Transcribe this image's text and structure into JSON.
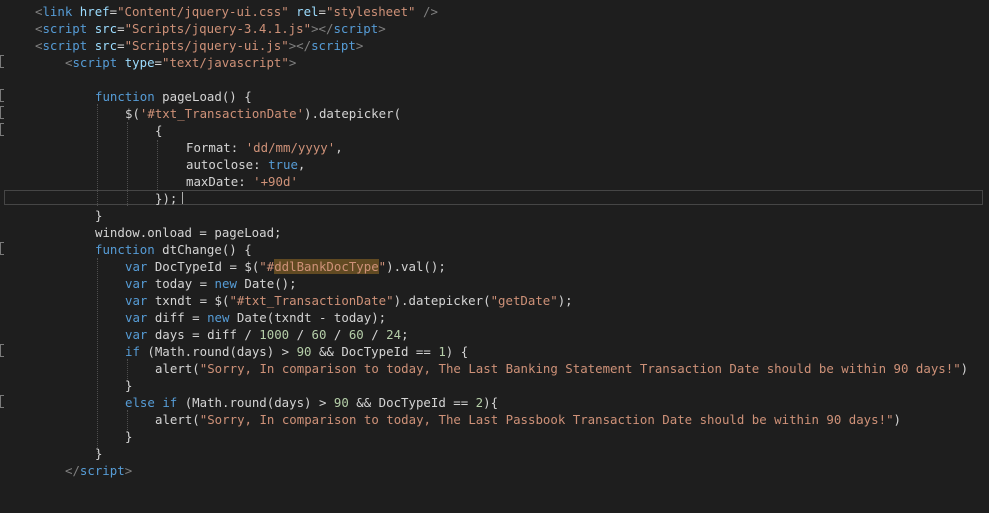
{
  "editor": {
    "lines": [
      {
        "tokens": [
          {
            "text": "<",
            "class": "tag-bracket"
          },
          {
            "text": "link",
            "class": "tag-name"
          },
          {
            "text": " ",
            "class": "plain"
          },
          {
            "text": "href",
            "class": "attr-name"
          },
          {
            "text": "=",
            "class": "plain"
          },
          {
            "text": "\"Content/jquery-ui.css\"",
            "class": "string"
          },
          {
            "text": " ",
            "class": "plain"
          },
          {
            "text": "rel",
            "class": "attr-name"
          },
          {
            "text": "=",
            "class": "plain"
          },
          {
            "text": "\"stylesheet\"",
            "class": "string"
          },
          {
            "text": " />",
            "class": "tag-bracket"
          }
        ]
      },
      {
        "tokens": [
          {
            "text": "<",
            "class": "tag-bracket"
          },
          {
            "text": "script",
            "class": "tag-name"
          },
          {
            "text": " ",
            "class": "plain"
          },
          {
            "text": "src",
            "class": "attr-name"
          },
          {
            "text": "=",
            "class": "plain"
          },
          {
            "text": "\"Scripts/jquery-3.4.1.js\"",
            "class": "string"
          },
          {
            "text": "></",
            "class": "tag-bracket"
          },
          {
            "text": "script",
            "class": "tag-name"
          },
          {
            "text": ">",
            "class": "tag-bracket"
          }
        ]
      },
      {
        "tokens": [
          {
            "text": "<",
            "class": "tag-bracket"
          },
          {
            "text": "script",
            "class": "tag-name"
          },
          {
            "text": " ",
            "class": "plain"
          },
          {
            "text": "src",
            "class": "attr-name"
          },
          {
            "text": "=",
            "class": "plain"
          },
          {
            "text": "\"Scripts/jquery-ui.js\"",
            "class": "string"
          },
          {
            "text": "></",
            "class": "tag-bracket"
          },
          {
            "text": "script",
            "class": "tag-name"
          },
          {
            "text": ">",
            "class": "tag-bracket"
          }
        ]
      },
      {
        "tokens": [
          {
            "text": "<",
            "class": "tag-bracket"
          },
          {
            "text": "script",
            "class": "tag-name"
          },
          {
            "text": " ",
            "class": "plain"
          },
          {
            "text": "type",
            "class": "attr-name"
          },
          {
            "text": "=",
            "class": "plain"
          },
          {
            "text": "\"text/javascript\"",
            "class": "string"
          },
          {
            "text": ">",
            "class": "tag-bracket"
          }
        ]
      },
      {
        "tokens": []
      },
      {
        "tokens": [
          {
            "text": "function",
            "class": "keyword"
          },
          {
            "text": " pageLoad() {",
            "class": "plain"
          }
        ]
      },
      {
        "tokens": [
          {
            "text": "$(",
            "class": "plain"
          },
          {
            "text": "'#txt_TransactionDate'",
            "class": "string"
          },
          {
            "text": ").datepicker(",
            "class": "plain"
          }
        ]
      },
      {
        "tokens": [
          {
            "text": "{",
            "class": "plain"
          }
        ]
      },
      {
        "tokens": [
          {
            "text": "Format: ",
            "class": "plain"
          },
          {
            "text": "'dd/mm/yyyy'",
            "class": "string"
          },
          {
            "text": ",",
            "class": "plain"
          }
        ]
      },
      {
        "tokens": [
          {
            "text": "autoclose: ",
            "class": "plain"
          },
          {
            "text": "true",
            "class": "keyword"
          },
          {
            "text": ",",
            "class": "plain"
          }
        ]
      },
      {
        "tokens": [
          {
            "text": "maxDate: ",
            "class": "plain"
          },
          {
            "text": "'+90d'",
            "class": "string"
          }
        ]
      },
      {
        "tokens": [
          {
            "text": "});",
            "class": "plain"
          }
        ]
      },
      {
        "tokens": [
          {
            "text": "}",
            "class": "plain"
          }
        ]
      },
      {
        "tokens": [
          {
            "text": "window.onload = pageLoad;",
            "class": "plain"
          }
        ]
      },
      {
        "tokens": [
          {
            "text": "function",
            "class": "keyword"
          },
          {
            "text": " dtChange() {",
            "class": "plain"
          }
        ]
      },
      {
        "tokens": [
          {
            "text": "var",
            "class": "keyword"
          },
          {
            "text": " DocTypeId = $(",
            "class": "plain"
          },
          {
            "text": "\"#",
            "class": "string"
          },
          {
            "text": "ddlBankDocType",
            "class": "highlight-word"
          },
          {
            "text": "\"",
            "class": "string"
          },
          {
            "text": ").val();",
            "class": "plain"
          }
        ]
      },
      {
        "tokens": [
          {
            "text": "var",
            "class": "keyword"
          },
          {
            "text": " today = ",
            "class": "plain"
          },
          {
            "text": "new",
            "class": "keyword"
          },
          {
            "text": " Date();",
            "class": "plain"
          }
        ]
      },
      {
        "tokens": [
          {
            "text": "var",
            "class": "keyword"
          },
          {
            "text": " txndt = $(",
            "class": "plain"
          },
          {
            "text": "\"#txt_TransactionDate\"",
            "class": "string"
          },
          {
            "text": ").datepicker(",
            "class": "plain"
          },
          {
            "text": "\"getDate\"",
            "class": "string"
          },
          {
            "text": ");",
            "class": "plain"
          }
        ]
      },
      {
        "tokens": [
          {
            "text": "var",
            "class": "keyword"
          },
          {
            "text": " diff = ",
            "class": "plain"
          },
          {
            "text": "new",
            "class": "keyword"
          },
          {
            "text": " Date(txndt - today);",
            "class": "plain"
          }
        ]
      },
      {
        "tokens": [
          {
            "text": "var",
            "class": "keyword"
          },
          {
            "text": " days = diff / ",
            "class": "plain"
          },
          {
            "text": "1000",
            "class": "number"
          },
          {
            "text": " / ",
            "class": "plain"
          },
          {
            "text": "60",
            "class": "number"
          },
          {
            "text": " / ",
            "class": "plain"
          },
          {
            "text": "60",
            "class": "number"
          },
          {
            "text": " / ",
            "class": "plain"
          },
          {
            "text": "24",
            "class": "number"
          },
          {
            "text": ";",
            "class": "plain"
          }
        ]
      },
      {
        "tokens": [
          {
            "text": "if",
            "class": "keyword"
          },
          {
            "text": " (Math.round(days) > ",
            "class": "plain"
          },
          {
            "text": "90",
            "class": "number"
          },
          {
            "text": " && DocTypeId == ",
            "class": "plain"
          },
          {
            "text": "1",
            "class": "number"
          },
          {
            "text": ") {",
            "class": "plain"
          }
        ]
      },
      {
        "tokens": [
          {
            "text": "alert(",
            "class": "plain"
          },
          {
            "text": "\"Sorry, In comparison to today, The Last Banking Statement Transaction Date should be within 90 days!\"",
            "class": "string"
          },
          {
            "text": ")",
            "class": "plain"
          }
        ]
      },
      {
        "tokens": [
          {
            "text": "}",
            "class": "plain"
          }
        ]
      },
      {
        "tokens": [
          {
            "text": "else",
            "class": "keyword"
          },
          {
            "text": " ",
            "class": "plain"
          },
          {
            "text": "if",
            "class": "keyword"
          },
          {
            "text": " (Math.round(days) > ",
            "class": "plain"
          },
          {
            "text": "90",
            "class": "number"
          },
          {
            "text": " && DocTypeId == ",
            "class": "plain"
          },
          {
            "text": "2",
            "class": "number"
          },
          {
            "text": "){",
            "class": "plain"
          }
        ]
      },
      {
        "tokens": [
          {
            "text": "alert(",
            "class": "plain"
          },
          {
            "text": "\"Sorry, In comparison to today, The Last Passbook Transaction Date should be within 90 days!\"",
            "class": "string"
          },
          {
            "text": ")",
            "class": "plain"
          }
        ]
      },
      {
        "tokens": [
          {
            "text": "}",
            "class": "plain"
          }
        ]
      },
      {
        "tokens": [
          {
            "text": "}",
            "class": "plain"
          }
        ]
      },
      {
        "tokens": [
          {
            "text": "</",
            "class": "tag-bracket"
          },
          {
            "text": "script",
            "class": "tag-name"
          },
          {
            "text": ">",
            "class": "tag-bracket"
          }
        ]
      }
    ]
  },
  "colors": {
    "background": "#1e1e1e",
    "keyword": "#569cd6",
    "string": "#ce9178",
    "attribute": "#9cdcfe",
    "number": "#b5cea8",
    "highlight": "#614a22"
  }
}
